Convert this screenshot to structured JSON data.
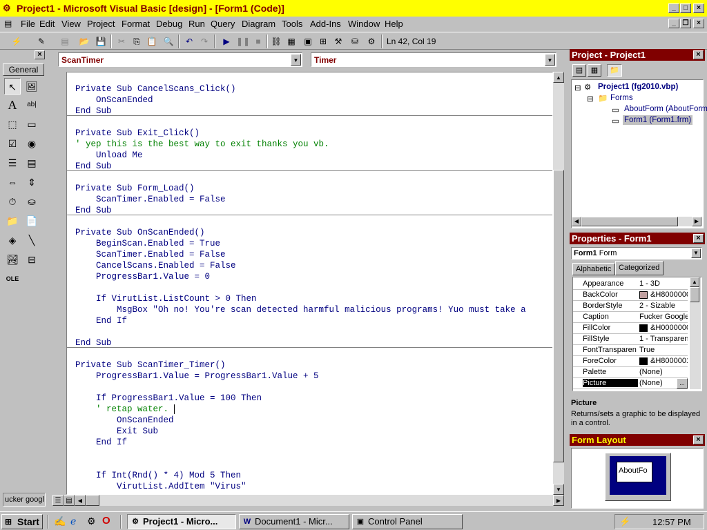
{
  "window": {
    "title": "Project1 - Microsoft Visual Basic [design] - [Form1 (Code)]",
    "app_icon": "vb-icon"
  },
  "menu": [
    "File",
    "Edit",
    "View",
    "Project",
    "Format",
    "Debug",
    "Run",
    "Query",
    "Diagram",
    "Tools",
    "Add-Ins",
    "Window",
    "Help"
  ],
  "toolbar": {
    "position": "Ln 42, Col 19"
  },
  "toolbox": {
    "tab_label": "General",
    "bottom_label": "ucker googl"
  },
  "code_window": {
    "object_combo": "ScanTimer",
    "procedure_combo": "Timer",
    "lines": [
      {
        "text": "Private Sub CancelScans_Click()",
        "type": "code"
      },
      {
        "text": "    OnScanEnded",
        "type": "code"
      },
      {
        "text": "End Sub",
        "type": "code"
      },
      {
        "text": "Private Sub Exit_Click()",
        "type": "code"
      },
      {
        "text": "' yep this is the best way to exit thanks you vb.",
        "type": "comment"
      },
      {
        "text": "    Unload Me",
        "type": "code"
      },
      {
        "text": "End Sub",
        "type": "code"
      },
      {
        "text": "Private Sub Form_Load()",
        "type": "code"
      },
      {
        "text": "    ScanTimer.Enabled = False",
        "type": "code"
      },
      {
        "text": "End Sub",
        "type": "code"
      },
      {
        "text": "Private Sub OnScanEnded()",
        "type": "code"
      },
      {
        "text": "    BeginScan.Enabled = True",
        "type": "code"
      },
      {
        "text": "    ScanTimer.Enabled = False",
        "type": "code"
      },
      {
        "text": "    CancelScans.Enabled = False",
        "type": "code"
      },
      {
        "text": "    ProgressBar1.Value = 0",
        "type": "code"
      },
      {
        "text": "",
        "type": "code"
      },
      {
        "text": "    If VirutList.ListCount > 0 Then",
        "type": "code"
      },
      {
        "text": "        MsgBox \"Oh no! You're scan detected harmful malicious programs! Yuo must take a",
        "type": "code"
      },
      {
        "text": "    End If",
        "type": "code"
      },
      {
        "text": "",
        "type": "code"
      },
      {
        "text": "End Sub",
        "type": "code"
      },
      {
        "text": "Private Sub ScanTimer_Timer()",
        "type": "code"
      },
      {
        "text": "    ProgressBar1.Value = ProgressBar1.Value + 5",
        "type": "code"
      },
      {
        "text": "",
        "type": "code"
      },
      {
        "text": "    If ProgressBar1.Value = 100 Then",
        "type": "code"
      },
      {
        "text": "    ' retap water.",
        "type": "comment"
      },
      {
        "text": "        OnScanEnded",
        "type": "code"
      },
      {
        "text": "        Exit Sub",
        "type": "code"
      },
      {
        "text": "    End If",
        "type": "code"
      },
      {
        "text": "",
        "type": "code"
      },
      {
        "text": "",
        "type": "code"
      },
      {
        "text": "    If Int(Rnd() * 4) Mod 5 Then",
        "type": "code"
      },
      {
        "text": "        VirutList.AddItem \"Virus\"",
        "type": "code"
      }
    ]
  },
  "project_panel": {
    "title": "Project - Project1",
    "root": "Project1 (fg2010.vbp)",
    "folder": "Forms",
    "items": [
      "AboutForm (AboutForm",
      "Form1 (Form1.frm)"
    ]
  },
  "properties_panel": {
    "title": "Properties - Form1",
    "object": "Form1",
    "object_type": "Form",
    "tabs": [
      "Alphabetic",
      "Categorized"
    ],
    "rows": [
      {
        "name": "Appearance",
        "value": "1 - 3D",
        "swatch": ""
      },
      {
        "name": "BackColor",
        "value": "&H8000000",
        "swatch": "#c0a0a0"
      },
      {
        "name": "BorderStyle",
        "value": "2 - Sizable",
        "swatch": ""
      },
      {
        "name": "Caption",
        "value": "Fucker Google",
        "swatch": ""
      },
      {
        "name": "FillColor",
        "value": "&H0000000",
        "swatch": "#000000"
      },
      {
        "name": "FillStyle",
        "value": "1 - Transparen",
        "swatch": ""
      },
      {
        "name": "FontTransparen",
        "value": "True",
        "swatch": ""
      },
      {
        "name": "ForeColor",
        "value": "&H8000001",
        "swatch": "#000000"
      },
      {
        "name": "Palette",
        "value": "(None)",
        "swatch": ""
      },
      {
        "name": "Picture",
        "value": "(None)",
        "swatch": ""
      }
    ],
    "desc_title": "Picture",
    "desc_text": "Returns/sets a graphic to be displayed in a control."
  },
  "form_layout": {
    "title": "Form Layout",
    "form_label": "AboutFo"
  },
  "taskbar": {
    "start": "Start",
    "tasks": [
      "Project1 - Micro...",
      "Document1 - Micr...",
      "Control Panel"
    ],
    "clock": "12:57 PM"
  },
  "colors": {
    "title_bg": "#ffff00",
    "title_fg": "#800000",
    "panel_title_bg": "#800000",
    "code_blue": "#000080",
    "comment_green": "#008000"
  }
}
